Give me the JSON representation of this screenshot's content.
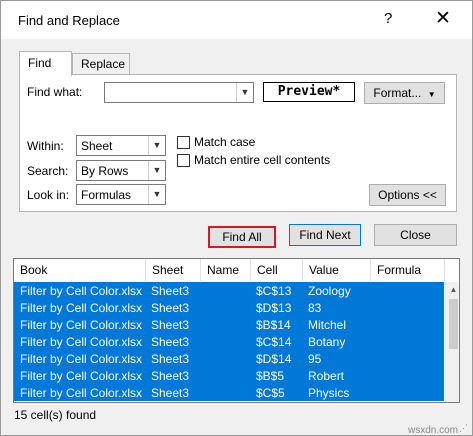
{
  "window": {
    "title": "Find and Replace",
    "help_glyph": "?",
    "close_glyph": "✕"
  },
  "tabs": [
    {
      "label": "Find",
      "active": true
    },
    {
      "label": "Replace",
      "active": false
    }
  ],
  "find": {
    "find_what_label": "Find what:",
    "find_what_value": "",
    "preview_text": "Preview*",
    "format_button": "Format...",
    "within_label": "Within:",
    "within_value": "Sheet",
    "search_label": "Search:",
    "search_value": "By Rows",
    "look_in_label": "Look in:",
    "look_in_value": "Formulas",
    "match_case_label": "Match case",
    "match_case_checked": false,
    "match_entire_label": "Match entire cell contents",
    "match_entire_checked": false,
    "options_button": "Options <<"
  },
  "buttons": {
    "find_all": "Find All",
    "find_next": "Find Next",
    "close": "Close"
  },
  "results": {
    "columns": [
      "Book",
      "Sheet",
      "Name",
      "Cell",
      "Value",
      "Formula"
    ],
    "rows": [
      {
        "book": "Filter by Cell Color.xlsx",
        "sheet": "Sheet3",
        "name": "",
        "cell": "$C$13",
        "value": "Zoology",
        "formula": ""
      },
      {
        "book": "Filter by Cell Color.xlsx",
        "sheet": "Sheet3",
        "name": "",
        "cell": "$D$13",
        "value": "83",
        "formula": ""
      },
      {
        "book": "Filter by Cell Color.xlsx",
        "sheet": "Sheet3",
        "name": "",
        "cell": "$B$14",
        "value": "Mitchel",
        "formula": ""
      },
      {
        "book": "Filter by Cell Color.xlsx",
        "sheet": "Sheet3",
        "name": "",
        "cell": "$C$14",
        "value": "Botany",
        "formula": ""
      },
      {
        "book": "Filter by Cell Color.xlsx",
        "sheet": "Sheet3",
        "name": "",
        "cell": "$D$14",
        "value": "95",
        "formula": ""
      },
      {
        "book": "Filter by Cell Color.xlsx",
        "sheet": "Sheet3",
        "name": "",
        "cell": "$B$5",
        "value": "Robert",
        "formula": ""
      },
      {
        "book": "Filter by Cell Color.xlsx",
        "sheet": "Sheet3",
        "name": "",
        "cell": "$C$5",
        "value": "Physics",
        "formula": ""
      }
    ],
    "selection_color": "#0078d7"
  },
  "status": "15 cell(s) found",
  "watermark": "wsxdn.com",
  "colors": {
    "find_all_highlight": "#d11b24",
    "default_button_border": "#0078d7"
  }
}
